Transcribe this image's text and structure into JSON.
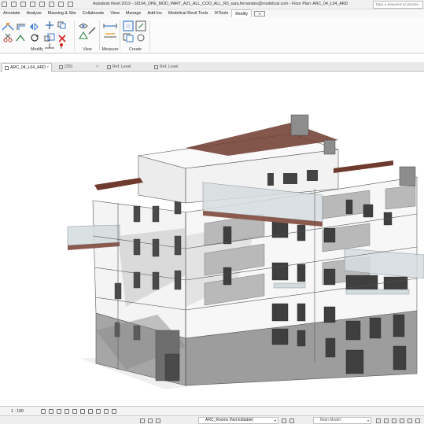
{
  "titlebar": {
    "title": "Autodesk Revit 2019 - 18194_OPE_MOD_PART_A21_ALL_COO_ALL_R0_sara.fernandes@modelical.com - Floor Plan: ARC_04_L04_ARD",
    "search_placeholder": "Type a keyword or phrase"
  },
  "menu": {
    "tabs": [
      "Annotate",
      "Analyze",
      "Massing & Site",
      "Collaborate",
      "View",
      "Manage",
      "Add-Ins",
      "Modelical Revit Tools",
      "IXTools",
      "Modify"
    ],
    "active_tab": "Modify",
    "context_button": "▾"
  },
  "ribbon": {
    "groups": {
      "modify": "Modify",
      "view": "View",
      "measure": "Measure",
      "create": "Create"
    }
  },
  "doc_tabs": [
    {
      "label": "ARC_04_L04_ARD",
      "active": true,
      "close": "×"
    },
    {
      "label": "{3D}",
      "active": false,
      "close": "×"
    },
    {
      "label": "Ref. Level",
      "active": false,
      "close": ""
    },
    {
      "label": "Ref. Level",
      "active": false,
      "close": ""
    }
  ],
  "viewbar": {
    "scale": "1 : 100"
  },
  "statusbar": {
    "workset": "ARC_Rooms (Not Editable)",
    "workset_dropdown": "▾",
    "model": "Main Model",
    "model_dropdown": "▾"
  },
  "colors": {
    "roof_wood": "#6e3a2e",
    "facade_white": "#ffffff",
    "facade_gray": "#9b9b9b",
    "shadow_gray": "#c9c9c9",
    "glass": "#d3dcde"
  },
  "icons": [
    "close-icon",
    "save-icon",
    "undo-icon",
    "redo-icon",
    "move-icon",
    "copy-icon",
    "rotate-icon",
    "mirror-icon",
    "trim-icon",
    "delete-icon",
    "measure-icon",
    "create-group-icon"
  ]
}
